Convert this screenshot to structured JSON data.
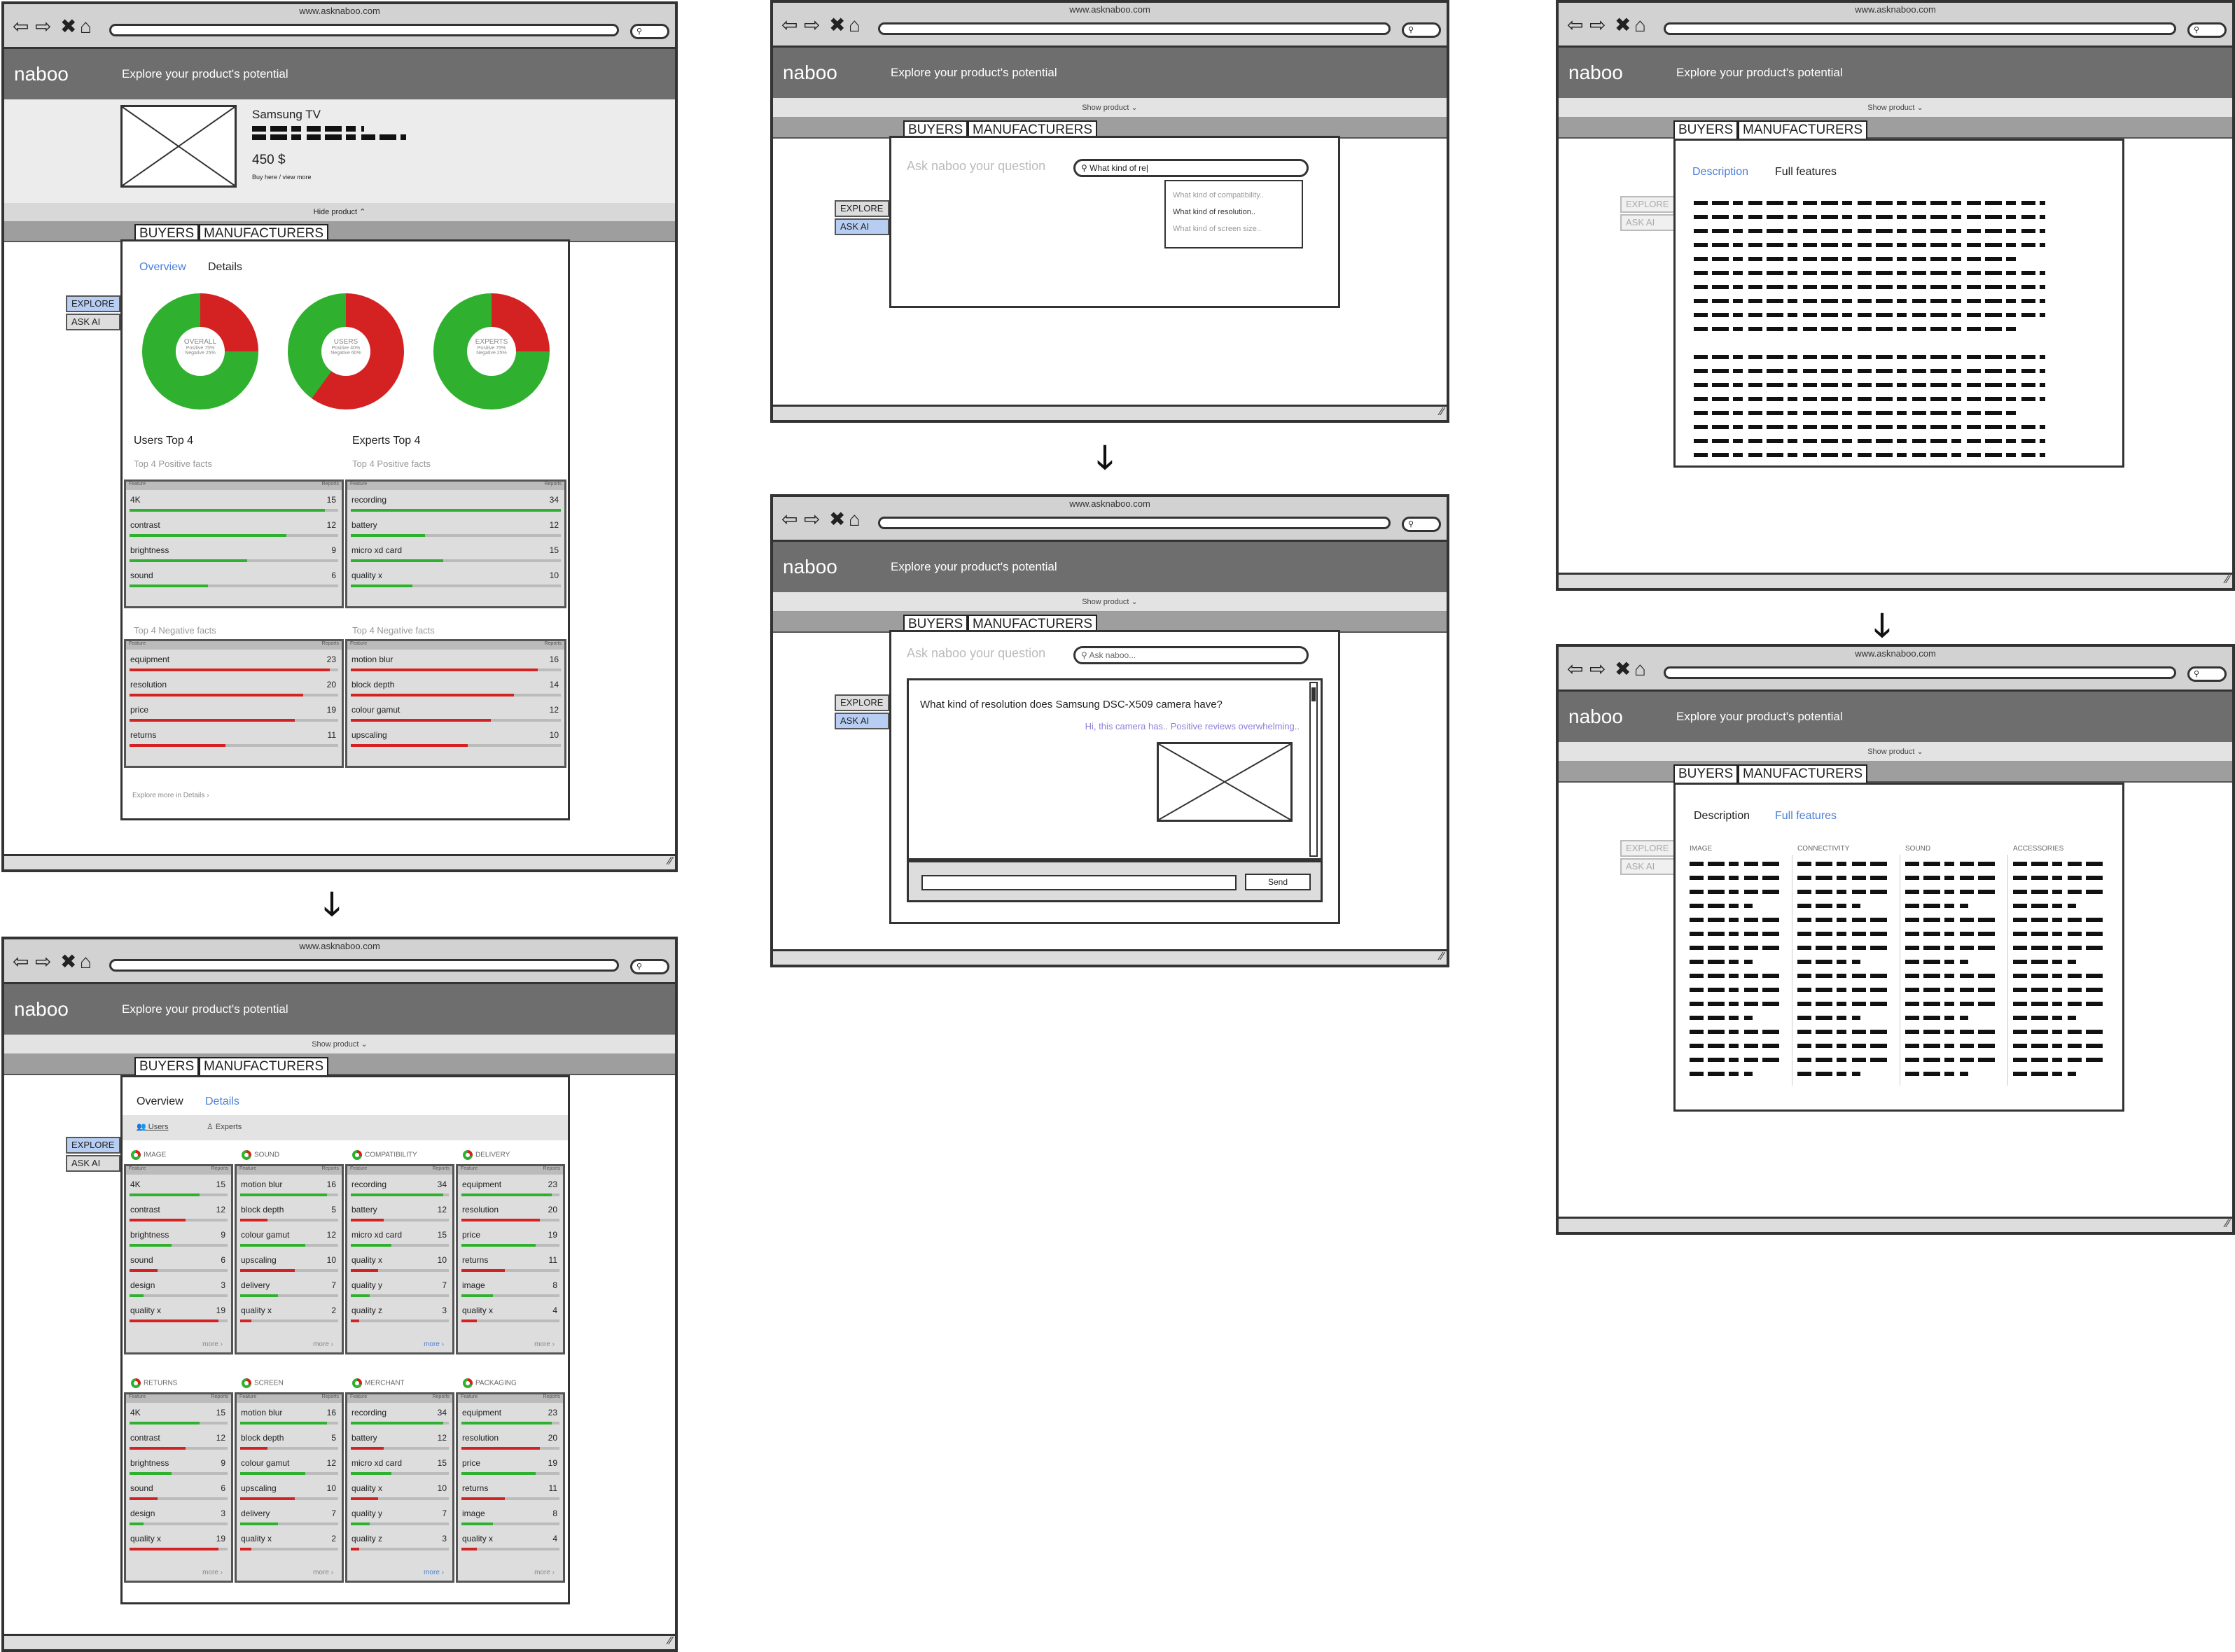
{
  "browser": {
    "url": "www.asknaboo.com"
  },
  "app": {
    "logo": "naboo",
    "tagline": "Explore your product's potential",
    "show_product": "Show product ⌄",
    "hide_product": "Hide product ⌃"
  },
  "tabs": {
    "buyers": "BUYERS",
    "manufacturers": "MANUFACTURERS"
  },
  "side": {
    "explore": "EXPLORE",
    "ask": "ASK AI"
  },
  "product": {
    "name": "Samsung TV",
    "price": "450 $",
    "links": "Buy here / view more"
  },
  "overview": {
    "tab_overview": "Overview",
    "tab_details": "Details",
    "donuts": [
      {
        "label": "OVERALL",
        "pos": "Positive 75%",
        "neg": "Negative 25%"
      },
      {
        "label": "USERS",
        "pos": "Positive 40%",
        "neg": "Negative 60%"
      },
      {
        "label": "EXPERTS",
        "pos": "Positive 75%",
        "neg": "Negative 25%"
      }
    ],
    "users_top": "Users Top 4",
    "experts_top": "Experts Top 4",
    "pos_sub": "Top 4 Positive facts",
    "neg_sub": "Top 4 Negative facts",
    "explore_more": "Explore more in Details ›",
    "users_pos": [
      [
        "4K",
        "15"
      ],
      [
        "contrast",
        "12"
      ],
      [
        "brightness",
        "9"
      ],
      [
        "sound",
        "6"
      ]
    ],
    "experts_pos": [
      [
        "recording",
        "34"
      ],
      [
        "battery",
        "12"
      ],
      [
        "micro xd card",
        "15"
      ],
      [
        "quality x",
        "10"
      ]
    ],
    "users_neg": [
      [
        "equipment",
        "23"
      ],
      [
        "resolution",
        "20"
      ],
      [
        "price",
        "19"
      ],
      [
        "returns",
        "11"
      ]
    ],
    "experts_neg": [
      [
        "motion blur",
        "16"
      ],
      [
        "block depth",
        "14"
      ],
      [
        "colour gamut",
        "12"
      ],
      [
        "upscaling",
        "10"
      ]
    ]
  },
  "details": {
    "users": "Users",
    "experts": "Experts",
    "more": "more ›",
    "cats": [
      {
        "name": "IMAGE",
        "rows": [
          [
            "4K",
            "15"
          ],
          [
            "contrast",
            "12"
          ],
          [
            "brightness",
            "9"
          ],
          [
            "sound",
            "6"
          ],
          [
            "design",
            "3"
          ],
          [
            "quality x",
            "19"
          ]
        ]
      },
      {
        "name": "SOUND",
        "rows": [
          [
            "motion blur",
            "16"
          ],
          [
            "block depth",
            "5"
          ],
          [
            "colour gamut",
            "12"
          ],
          [
            "upscaling",
            "10"
          ],
          [
            "delivery",
            "7"
          ],
          [
            "quality x",
            "2"
          ]
        ]
      },
      {
        "name": "COMPATIBILITY",
        "rows": [
          [
            "recording",
            "34"
          ],
          [
            "battery",
            "12"
          ],
          [
            "micro xd card",
            "15"
          ],
          [
            "quality x",
            "10"
          ],
          [
            "quality y",
            "7"
          ],
          [
            "quality z",
            "3"
          ]
        ]
      },
      {
        "name": "DELIVERY",
        "rows": [
          [
            "equipment",
            "23"
          ],
          [
            "resolution",
            "20"
          ],
          [
            "price",
            "19"
          ],
          [
            "returns",
            "11"
          ],
          [
            "image",
            "8"
          ],
          [
            "quality x",
            "4"
          ]
        ]
      },
      {
        "name": "RETURNS",
        "rows": [
          [
            "4K",
            "15"
          ],
          [
            "contrast",
            "12"
          ],
          [
            "brightness",
            "9"
          ],
          [
            "sound",
            "6"
          ],
          [
            "design",
            "3"
          ],
          [
            "quality x",
            "19"
          ]
        ]
      },
      {
        "name": "SCREEN",
        "rows": [
          [
            "motion blur",
            "16"
          ],
          [
            "block depth",
            "5"
          ],
          [
            "colour gamut",
            "12"
          ],
          [
            "upscaling",
            "10"
          ],
          [
            "delivery",
            "7"
          ],
          [
            "quality x",
            "2"
          ]
        ]
      },
      {
        "name": "MERCHANT",
        "rows": [
          [
            "recording",
            "34"
          ],
          [
            "battery",
            "12"
          ],
          [
            "micro xd card",
            "15"
          ],
          [
            "quality x",
            "10"
          ],
          [
            "quality y",
            "7"
          ],
          [
            "quality z",
            "3"
          ]
        ]
      },
      {
        "name": "PACKAGING",
        "rows": [
          [
            "equipment",
            "23"
          ],
          [
            "resolution",
            "20"
          ],
          [
            "price",
            "19"
          ],
          [
            "returns",
            "11"
          ],
          [
            "image",
            "8"
          ],
          [
            "quality x",
            "4"
          ]
        ]
      }
    ]
  },
  "ask": {
    "prompt": "Ask naboo your question",
    "query": "What kind of re|",
    "suggestions": [
      "What kind of compatibility..",
      "What kind of resolution..",
      "What kind of screen size.."
    ],
    "placeholder2": "Ask naboo...",
    "question": "What kind of resolution does Samsung DSC-X509 camera have?",
    "answer": "Hi, this camera has.. Positive reviews overwhelming..",
    "send": "Send"
  },
  "manu": {
    "description": "Description",
    "full_features": "Full features",
    "columns": [
      "IMAGE",
      "CONNECTIVITY",
      "SOUND",
      "ACCESSORIES"
    ]
  },
  "colors": {
    "green": "#2fb12f",
    "red": "#d42222",
    "blue": "#4a7fd9"
  }
}
